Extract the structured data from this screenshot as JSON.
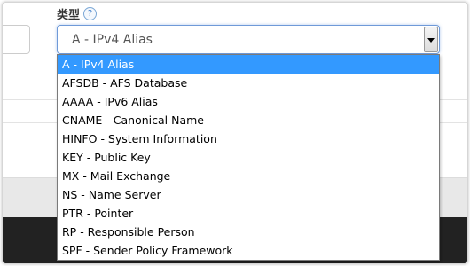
{
  "field": {
    "label": "类型",
    "help_icon": "?"
  },
  "select": {
    "value": "A - IPv4 Alias"
  },
  "dropdown": {
    "options": [
      "A - IPv4 Alias",
      "AFSDB - AFS Database",
      "AAAA - IPv6 Alias",
      "CNAME - Canonical Name",
      "HINFO - System Information",
      "KEY - Public Key",
      "MX - Mail Exchange",
      "NS - Name Server",
      "PTR - Pointer",
      "RP - Responsible Person",
      "SPF - Sender Policy Framework"
    ],
    "selected_index": 0
  },
  "colors": {
    "selection": "#3399ff",
    "focus_border": "#6f9ad8",
    "footer_dark": "#222222"
  }
}
